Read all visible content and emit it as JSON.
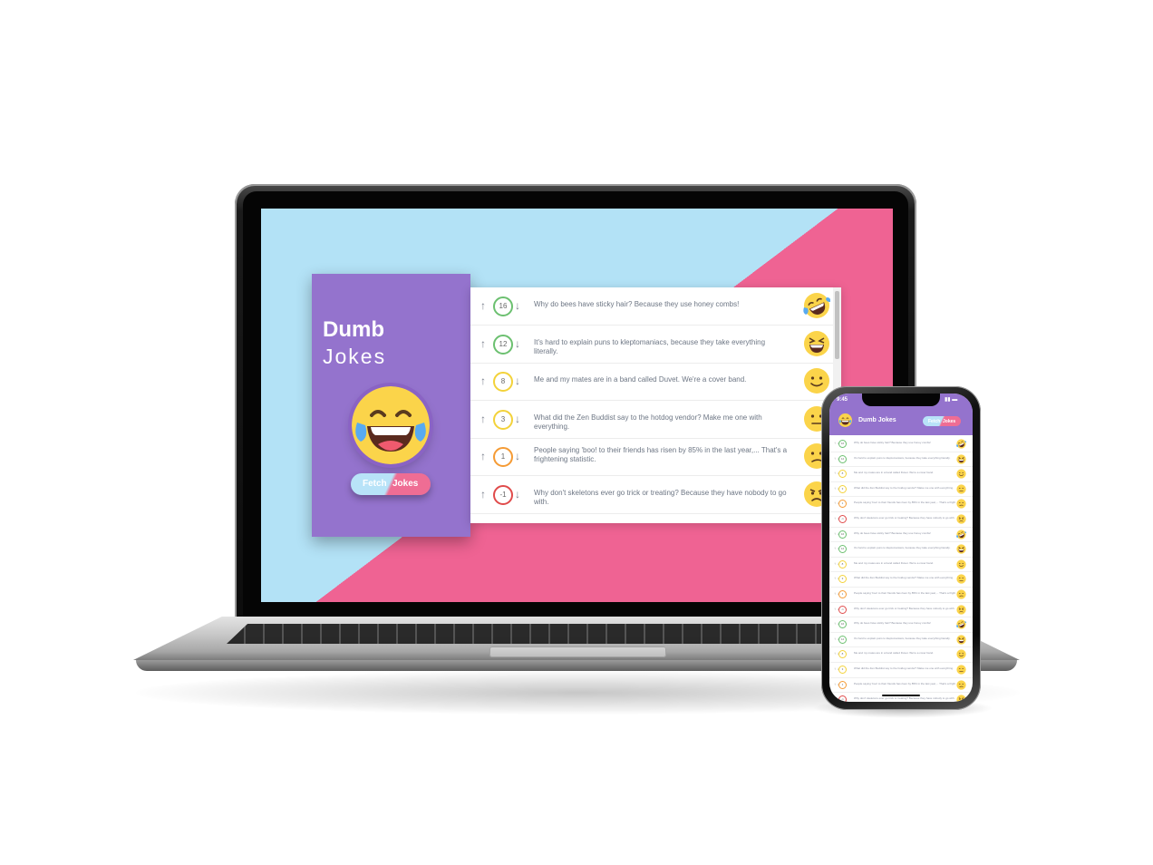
{
  "colors": {
    "brand_purple": "#9473cd",
    "bg_blue": "#b3e2f6",
    "bg_pink": "#ef6393",
    "vote_green": "#6cc070",
    "vote_yellow": "#f3d23a",
    "vote_orange": "#f59b35",
    "vote_red": "#e04b4b"
  },
  "desktop": {
    "title_line1": "Dumb",
    "title_line2": "Jokes",
    "hero_icon": "laughing-tears-emoji",
    "fetch_button": {
      "part1": "Fetch",
      "part2": "Jokes"
    },
    "jokes": [
      {
        "votes": "16",
        "text": "Why do bees have sticky hair? Because they use honey combs!",
        "rating": "rofl",
        "color": "#6cc070"
      },
      {
        "votes": "12",
        "text": "It's hard to explain puns to kleptomaniacs, because they take everything literally.",
        "rating": "laughing",
        "color": "#6cc070"
      },
      {
        "votes": "8",
        "text": "Me and my mates are in a band called Duvet. We're a cover band.",
        "rating": "smile",
        "color": "#f3d23a"
      },
      {
        "votes": "3",
        "text": "What did the Zen Buddist say to the hotdog vendor? Make me one with everything.",
        "rating": "neutral",
        "color": "#f3d23a"
      },
      {
        "votes": "1",
        "text": "People saying 'boo! to their friends has risen by 85% in the last year,... That's a frightening statistic.",
        "rating": "confused",
        "color": "#f59b35"
      },
      {
        "votes": "-1",
        "text": "Why don't skeletons ever go trick or treating? Because they have nobody to go with.",
        "rating": "angry",
        "color": "#e04b4b"
      }
    ]
  },
  "mobile": {
    "time": "9:45",
    "title": "Dumb Jokes",
    "fetch_button": {
      "part1": "Fetch",
      "part2": "Jokes"
    },
    "jokes": [
      {
        "votes": "16",
        "text": "Why do bees have sticky hair? Because they use honey combs!",
        "rating": "rofl",
        "color": "#6cc070"
      },
      {
        "votes": "12",
        "text": "It's hard to explain puns to kleptomaniacs, because they take everything literally.",
        "rating": "laughing",
        "color": "#6cc070"
      },
      {
        "votes": "8",
        "text": "Me and my mates are in a band called Duvet. We're a cover band.",
        "rating": "smile",
        "color": "#f3d23a"
      },
      {
        "votes": "3",
        "text": "What did the Zen Buddist say to the hotdog vendor? Make me one with everything.",
        "rating": "neutral",
        "color": "#f3d23a"
      },
      {
        "votes": "1",
        "text": "People saying 'boo! to their friends has risen by 85% in the last year,... That's a frightening statistic.",
        "rating": "confused",
        "color": "#f59b35"
      },
      {
        "votes": "-1",
        "text": "Why don't skeletons ever go trick or treating? Because they have nobody to go with.",
        "rating": "angry",
        "color": "#e04b4b"
      },
      {
        "votes": "16",
        "text": "Why do bees have sticky hair? Because they use honey combs!",
        "rating": "rofl",
        "color": "#6cc070"
      },
      {
        "votes": "12",
        "text": "It's hard to explain puns to kleptomaniacs, because they take everything literally.",
        "rating": "laughing",
        "color": "#6cc070"
      },
      {
        "votes": "8",
        "text": "Me and my mates are in a band called Duvet. We're a cover band.",
        "rating": "smile",
        "color": "#f3d23a"
      },
      {
        "votes": "3",
        "text": "What did the Zen Buddist say to the hotdog vendor? Make me one with everything.",
        "rating": "neutral",
        "color": "#f3d23a"
      },
      {
        "votes": "1",
        "text": "People saying 'boo! to their friends has risen by 85% in the last year,... That's a frightening statistic.",
        "rating": "confused",
        "color": "#f59b35"
      },
      {
        "votes": "-1",
        "text": "Why don't skeletons ever go trick or treating? Because they have nobody to go with.",
        "rating": "angry",
        "color": "#e04b4b"
      },
      {
        "votes": "16",
        "text": "Why do bees have sticky hair? Because they use honey combs!",
        "rating": "rofl",
        "color": "#6cc070"
      },
      {
        "votes": "12",
        "text": "It's hard to explain puns to kleptomaniacs, because they take everything literally.",
        "rating": "laughing",
        "color": "#6cc070"
      },
      {
        "votes": "8",
        "text": "Me and my mates are in a band called Duvet. We're a cover band.",
        "rating": "smile",
        "color": "#f3d23a"
      },
      {
        "votes": "3",
        "text": "What did the Zen Buddist say to the hotdog vendor? Make me one with everything.",
        "rating": "neutral",
        "color": "#f3d23a"
      },
      {
        "votes": "1",
        "text": "People saying 'boo! to their friends has risen by 85% in the last year,... That's a frightening statistic.",
        "rating": "confused",
        "color": "#f59b35"
      },
      {
        "votes": "-1",
        "text": "Why don't skeletons ever go trick or treating? Because they have nobody to go with.",
        "rating": "angry",
        "color": "#e04b4b"
      }
    ]
  }
}
